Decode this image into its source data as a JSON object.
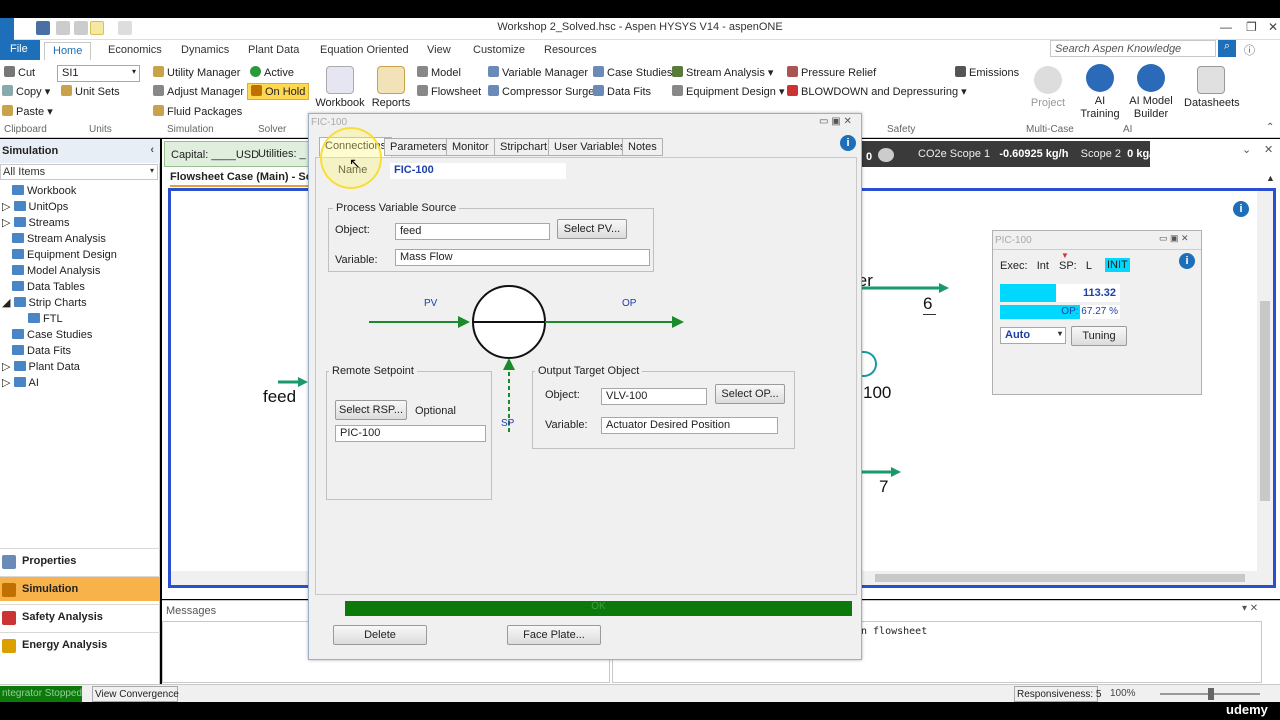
{
  "window": {
    "title": "Workshop 2_Solved.hsc - Aspen HYSYS V14 - aspenONE"
  },
  "menu": {
    "file": "File",
    "tabs": [
      "Home",
      "Economics",
      "Dynamics",
      "Plant Data",
      "Equation Oriented",
      "View",
      "Customize",
      "Resources"
    ],
    "search_placeholder": "Search Aspen Knowledge"
  },
  "ribbon": {
    "clipboard": {
      "cut": "Cut",
      "copy": "Copy",
      "paste": "Paste",
      "group": "Clipboard"
    },
    "units": {
      "set": "SI1",
      "unit_sets": "Unit Sets",
      "group": "Units"
    },
    "simulation": {
      "utility_manager": "Utility Manager",
      "adjust_manager": "Adjust Manager",
      "fluid_packages": "Fluid Packages",
      "group": "Simulation"
    },
    "solver": {
      "active": "Active",
      "on_hold": "On Hold",
      "group": "Solver"
    },
    "big": {
      "workbook": "Workbook",
      "reports": "Reports"
    },
    "col3": {
      "model": "Model",
      "flowsheet": "Flowsheet"
    },
    "col4": {
      "variable_manager": "Variable Manager",
      "compressor_surge": "Compressor Surge"
    },
    "col5": {
      "case_studies": "Case Studies",
      "data_fits": "Data Fits"
    },
    "col6": {
      "stream_analysis": "Stream Analysis",
      "equipment_design": "Equipment Design"
    },
    "safety": {
      "pressure_relief": "Pressure Relief",
      "blowdown": "BLOWDOWN and Depressuring",
      "group": "Safety"
    },
    "emissions": "Emissions",
    "multicase": {
      "project": "Project",
      "group": "Multi-Case"
    },
    "ai": {
      "training": "AI\nTraining",
      "builder": "AI Model\nBuilder",
      "group": "AI"
    },
    "datasheets": "Datasheets"
  },
  "nav": {
    "header": "Simulation",
    "filter": "All Items",
    "items": [
      "Workbook",
      "UnitOps",
      "Streams",
      "Stream Analysis",
      "Equipment Design",
      "Model Analysis",
      "Data Tables",
      "Strip Charts",
      "FTL",
      "Case Studies",
      "Data Fits",
      "Plant Data",
      "AI"
    ],
    "buttons": [
      "Properties",
      "Simulation",
      "Safety Analysis",
      "Energy Analysis"
    ]
  },
  "econ": {
    "capital": "Capital: ____USD",
    "utilities": "Utilities: _",
    "co2_label": "CO2e Scope 1",
    "co2_value": "-0.60925 kg/h",
    "scope2_label": "Scope 2",
    "scope2_value": "0 kg/h",
    "zero": "0"
  },
  "flowsheet": {
    "tab": "Flowsheet Case (Main) - Sol",
    "feed": "feed",
    "stream6": "6",
    "stream7": "7",
    "cooler_partial": "ler",
    "unit_partial": "100"
  },
  "dialog": {
    "title": "FIC-100",
    "tabs": [
      "Connections",
      "Parameters",
      "Monitor",
      "Stripchart",
      "User Variables",
      "Notes"
    ],
    "name_label": "Name",
    "name_value": "FIC-100",
    "pv_group": "Process Variable Source",
    "object_label": "Object:",
    "pv_object": "feed",
    "select_pv": "Select PV...",
    "variable_label": "Variable:",
    "pv_variable": "Mass Flow",
    "pv_tag": "PV",
    "op_tag": "OP",
    "sp_tag": "SP",
    "rsp_group": "Remote Setpoint",
    "select_rsp": "Select RSP...",
    "optional": "Optional",
    "rsp_value": "PIC-100",
    "op_group": "Output Target Object",
    "op_object": "VLV-100",
    "select_op": "Select OP...",
    "op_variable": "Actuator Desired Position",
    "status": "OK",
    "delete": "Delete",
    "face_plate": "Face Plate..."
  },
  "faceplate": {
    "title": "PIC-100",
    "exec_label": "Exec:",
    "exec_value": "Int",
    "sp_label": "SP:",
    "sp_value": "L",
    "init": "INIT",
    "pv_value": "113.32",
    "op_label": "OP: 67.27 %",
    "mode": "Auto",
    "tuning": "Tuning",
    "pv_fill": 0.47,
    "op_fill": 0.67
  },
  "messages": {
    "title": "Messages",
    "text": "n flowsheet"
  },
  "statusbar": {
    "left": "ntegrator Stopped",
    "view_convergence": "View Convergence",
    "responsiveness": "Responsiveness: 5",
    "zoom": "100%"
  },
  "watermark": "udemy",
  "colors": {
    "accent": "#1c6fb8",
    "ok": "#0b7a0b",
    "cyan": "#00d8ff",
    "green_arrow": "#1a8a2a"
  }
}
